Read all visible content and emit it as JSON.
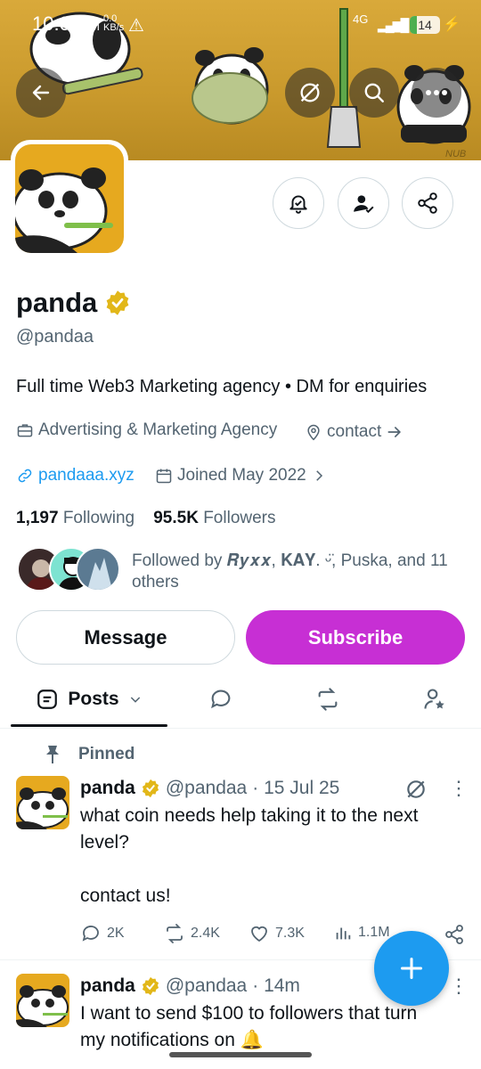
{
  "status_bar": {
    "time": "10:09",
    "ampm": "PM",
    "net_speed_value": "0.0",
    "net_speed_unit": "KB/s",
    "network": "4G",
    "battery": "14"
  },
  "profile": {
    "name": "panda",
    "handle": "@pandaa",
    "bio": "Full time Web3 Marketing agency • DM for enquiries",
    "category": "Advertising & Marketing Agency",
    "contact_label": "contact",
    "website": "pandaaa.xyz",
    "joined": "Joined May 2022",
    "following_count": "1,197",
    "following_label": "Following",
    "followers_count": "95.5K",
    "followers_label": "Followers",
    "followed_by": "Followed by 𝑹𝒚𝒙𝒙, 𝐊𝐀𝐘. ᵕ̈, Puska, and 11 others",
    "banner_signature": "NUB"
  },
  "buttons": {
    "message": "Message",
    "subscribe": "Subscribe"
  },
  "tabs": {
    "posts": "Posts"
  },
  "pinned_label": "Pinned",
  "posts": [
    {
      "name": "panda",
      "handle": "@pandaa",
      "time": "· 15 Jul 25",
      "text_line1": "what coin needs help taking it to the next",
      "text_line2": "level?",
      "text_line3": "contact us!",
      "replies": "2K",
      "reposts": "2.4K",
      "likes": "7.3K",
      "views": "1.1M"
    },
    {
      "name": "panda",
      "handle": "@pandaa",
      "time": "· 14m",
      "text_line1": "I want to send $100 to followers that turn",
      "text_line2": "my notifications on 🔔"
    }
  ],
  "colors": {
    "accent": "#1d9bf0",
    "subscribe": "#c72fd4",
    "verified": "#e2b719",
    "banner": "#d9a93a"
  }
}
